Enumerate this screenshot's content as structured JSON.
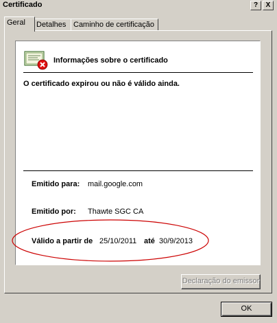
{
  "window": {
    "title": "Certificado",
    "help_label": "?",
    "close_label": "X"
  },
  "tabs": [
    {
      "label": "Geral"
    },
    {
      "label": "Detalhes"
    },
    {
      "label": "Caminho de certificação"
    }
  ],
  "cert_info": {
    "heading": "Informações sobre o certificado",
    "warning": "O certificado expirou ou não é válido ainda.",
    "issued_to_label": "Emitido para:",
    "issued_to_value": "mail.google.com",
    "issued_by_label": "Emitido por:",
    "issued_by_value": "Thawte SGC CA",
    "valid_from_label": "Válido a partir de",
    "valid_from_value": "25/10/2011",
    "valid_to_label": "até",
    "valid_to_value": "30/9/2013"
  },
  "buttons": {
    "issuer_statement": "Declaração do emissor",
    "ok": "OK"
  },
  "colors": {
    "window_bg": "#d4d0c8",
    "highlight_ellipse": "#cc0000",
    "error_badge": "#e01010"
  },
  "icons": {
    "certificate": "certificate-error-icon"
  }
}
